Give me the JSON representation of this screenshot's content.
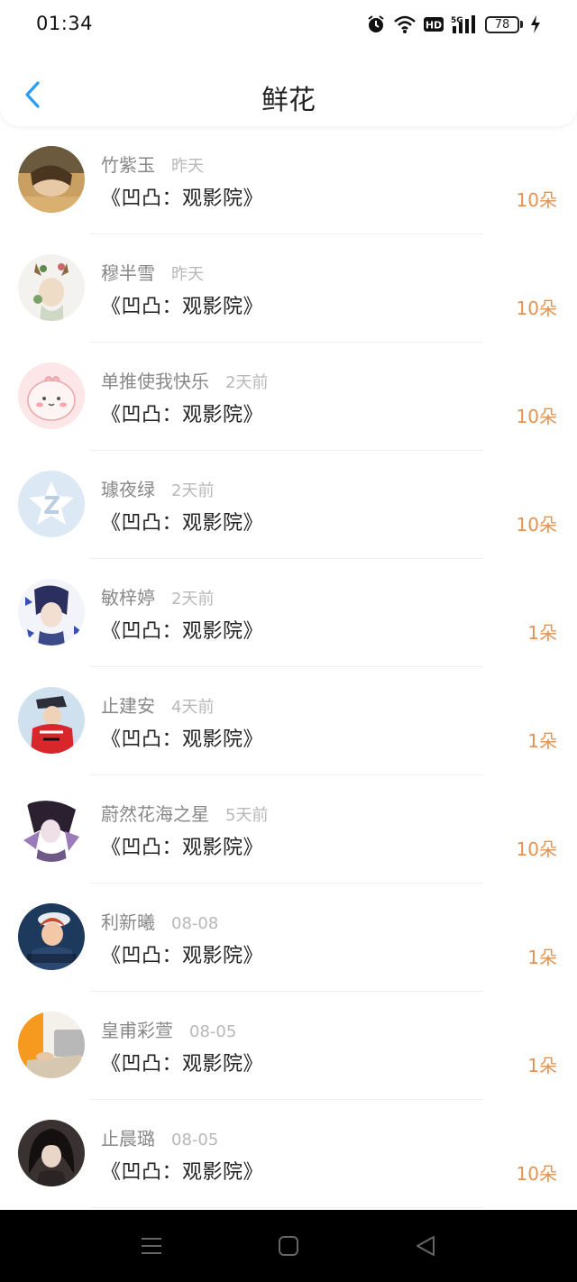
{
  "status_bar": {
    "time": "01:34",
    "network": "5G",
    "hd": "HD",
    "battery": "78",
    "icons": [
      "alarm-icon",
      "wifi-icon",
      "hd-icon",
      "signal-5g-icon",
      "battery-icon",
      "charging-icon"
    ]
  },
  "header": {
    "title": "鲜花",
    "back_icon": "chevron-left-icon",
    "accent_color": "#2a9df4"
  },
  "colors": {
    "amount": "#e8914d",
    "name": "#888888",
    "time": "#b8b8b8"
  },
  "items": [
    {
      "name": "竹紫玉",
      "time": "昨天",
      "work": "《凹凸：观影院》",
      "amount": "10朵"
    },
    {
      "name": "穆半雪",
      "time": "昨天",
      "work": "《凹凸：观影院》",
      "amount": "10朵"
    },
    {
      "name": "单推使我快乐",
      "time": "2天前",
      "work": "《凹凸：观影院》",
      "amount": "10朵"
    },
    {
      "name": "璩夜绿",
      "time": "2天前",
      "work": "《凹凸：观影院》",
      "amount": "10朵"
    },
    {
      "name": "敏梓婷",
      "time": "2天前",
      "work": "《凹凸：观影院》",
      "amount": "1朵"
    },
    {
      "name": "止建安",
      "time": "4天前",
      "work": "《凹凸：观影院》",
      "amount": "1朵"
    },
    {
      "name": "蔚然花海之星",
      "time": "5天前",
      "work": "《凹凸：观影院》",
      "amount": "10朵"
    },
    {
      "name": "利新曦",
      "time": "08-08",
      "work": "《凹凸：观影院》",
      "amount": "1朵"
    },
    {
      "name": "皇甫彩萱",
      "time": "08-05",
      "work": "《凹凸：观影院》",
      "amount": "1朵"
    },
    {
      "name": "止晨璐",
      "time": "08-05",
      "work": "《凹凸：观影院》",
      "amount": "10朵"
    }
  ],
  "nav_bar": {
    "icons": [
      "menu-icon",
      "home-square-icon",
      "back-triangle-icon"
    ]
  }
}
